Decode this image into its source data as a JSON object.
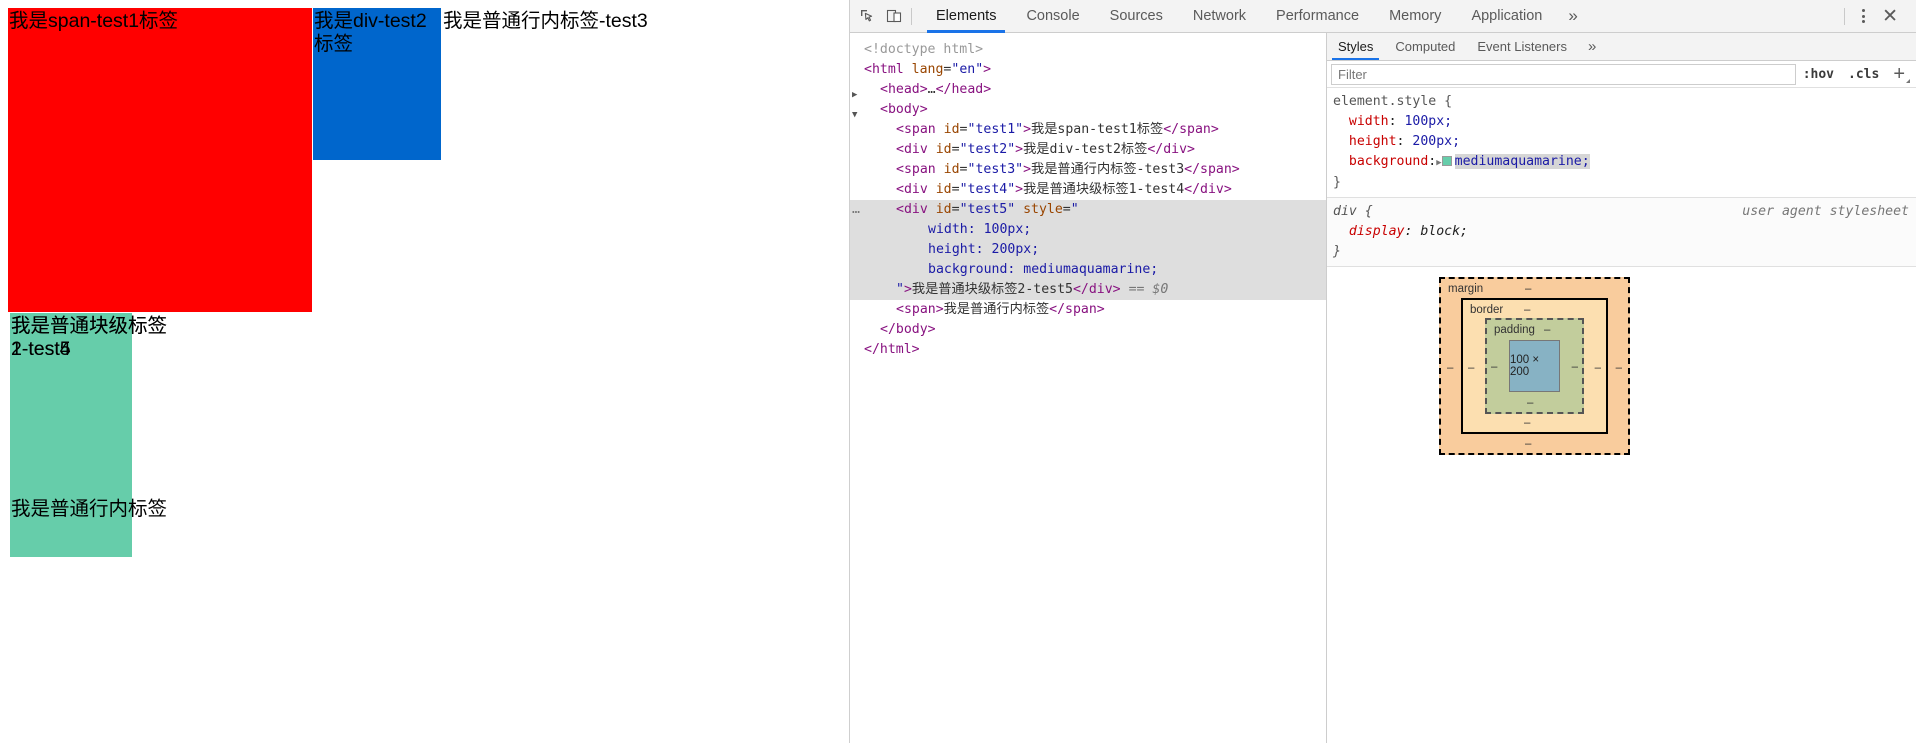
{
  "page": {
    "span_test1": "我是span-test1标签",
    "div_test2": "我是div-test2标签",
    "span_test3": "我是普通行内标签-test3",
    "div_test4": "我是普通块级标签1-test4",
    "div_test5": "我是普通块级标签2-test5",
    "span_plain": "我是普通行内标签",
    "colors": {
      "span_test1_bg": "#ff0000",
      "div_test2_bg": "#0066cc",
      "div_test5_bg": "#66cdaa"
    }
  },
  "devtools": {
    "toolbar": {
      "inspect_icon": "inspect-element-icon",
      "device_icon": "device-toolbar-icon",
      "tabs": [
        {
          "label": "Elements",
          "active": true
        },
        {
          "label": "Console",
          "active": false
        },
        {
          "label": "Sources",
          "active": false
        },
        {
          "label": "Network",
          "active": false
        },
        {
          "label": "Performance",
          "active": false
        },
        {
          "label": "Memory",
          "active": false
        },
        {
          "label": "Application",
          "active": false
        }
      ],
      "more_tabs": "»",
      "settings_icon": "kebab-menu-icon",
      "close_icon": "✕"
    },
    "elements": {
      "lines": [
        {
          "indent": 0,
          "html": "<span class=\"doct\">&lt;!doctype html&gt;</span>"
        },
        {
          "indent": 0,
          "html": "<span class=\"tw\">&lt;html</span> <span class=\"an\">lang</span>=<span class=\"av\">\"en\"</span><span class=\"tw\">&gt;</span>"
        },
        {
          "indent": 1,
          "html": "<span class=\"tw\">&lt;head&gt;</span><span class=\"txt\">…</span><span class=\"tw\">&lt;/head&gt;</span>",
          "arrow": "▶"
        },
        {
          "indent": 1,
          "html": "<span class=\"tw\">&lt;body&gt;</span>",
          "arrow": "▼"
        },
        {
          "indent": 2,
          "html": "<span class=\"tw\">&lt;span</span> <span class=\"an\">id</span>=<span class=\"av\">\"test1\"</span><span class=\"tw\">&gt;</span><span class=\"txt\">我是span-test1标签</span><span class=\"tw\">&lt;/span&gt;</span>"
        },
        {
          "indent": 2,
          "html": "<span class=\"tw\">&lt;div</span> <span class=\"an\">id</span>=<span class=\"av\">\"test2\"</span><span class=\"tw\">&gt;</span><span class=\"txt\">我是div-test2标签</span><span class=\"tw\">&lt;/div&gt;</span>"
        },
        {
          "indent": 2,
          "html": "<span class=\"tw\">&lt;span</span> <span class=\"an\">id</span>=<span class=\"av\">\"test3\"</span><span class=\"tw\">&gt;</span><span class=\"txt\">我是普通行内标签-test3</span><span class=\"tw\">&lt;/span&gt;</span>"
        },
        {
          "indent": 2,
          "html": "<span class=\"tw\">&lt;div</span> <span class=\"an\">id</span>=<span class=\"av\">\"test4\"</span><span class=\"tw\">&gt;</span><span class=\"txt\">我是普通块级标签1-test4</span><span class=\"tw\">&lt;/div&gt;</span>"
        }
      ],
      "selected_lines": [
        {
          "indent": 2,
          "html": "<span class=\"tw\">&lt;div</span> <span class=\"an\">id</span>=<span class=\"av\">\"test5\"</span> <span class=\"an\">style</span>=<span class=\"av\">\"</span>",
          "dots": "…"
        },
        {
          "indent": 4,
          "html": "<span class=\"av\">width: 100px;</span>"
        },
        {
          "indent": 4,
          "html": "<span class=\"av\">height: 200px;</span>"
        },
        {
          "indent": 4,
          "html": "<span class=\"av\">background: mediumaquamarine;</span>"
        },
        {
          "indent": 2,
          "html": "<span class=\"av\">\"</span><span class=\"tw\">&gt;</span><span class=\"txt\">我是普通块级标签2-test5</span><span class=\"tw\">&lt;/div&gt;</span> <span class=\"eq0\">== $0</span>"
        }
      ],
      "tail_lines": [
        {
          "indent": 2,
          "html": "<span class=\"tw\">&lt;span&gt;</span><span class=\"txt\">我是普通行内标签</span><span class=\"tw\">&lt;/span&gt;</span>"
        },
        {
          "indent": 1,
          "html": "<span class=\"tw\">&lt;/body&gt;</span>"
        },
        {
          "indent": 0,
          "html": "<span class=\"tw\">&lt;/html&gt;</span>"
        }
      ]
    },
    "styles": {
      "tabs": [
        {
          "label": "Styles",
          "active": true
        },
        {
          "label": "Computed",
          "active": false
        },
        {
          "label": "Event Listeners",
          "active": false
        }
      ],
      "more_tabs": "»",
      "filter_placeholder": "Filter",
      "hov_label": ":hov",
      "cls_label": ".cls",
      "plus_label": "+",
      "element_style": {
        "selector": "element.style {",
        "close": "}",
        "props": [
          {
            "name": "width",
            "value": "100px;"
          },
          {
            "name": "height",
            "value": "200px;"
          }
        ],
        "background_name": "background",
        "background_value": "mediumaquamarine;",
        "background_swatch": "#66cdaa",
        "expand_triangle": "▶"
      },
      "ua_rule": {
        "selector": "div {",
        "source": "user agent stylesheet",
        "prop_name": "display",
        "prop_value": "block;",
        "close": "}"
      }
    },
    "box_model": {
      "margin_label": "margin",
      "border_label": "border",
      "padding_label": "padding",
      "content_label": "100 × 200",
      "dash": "–"
    }
  }
}
